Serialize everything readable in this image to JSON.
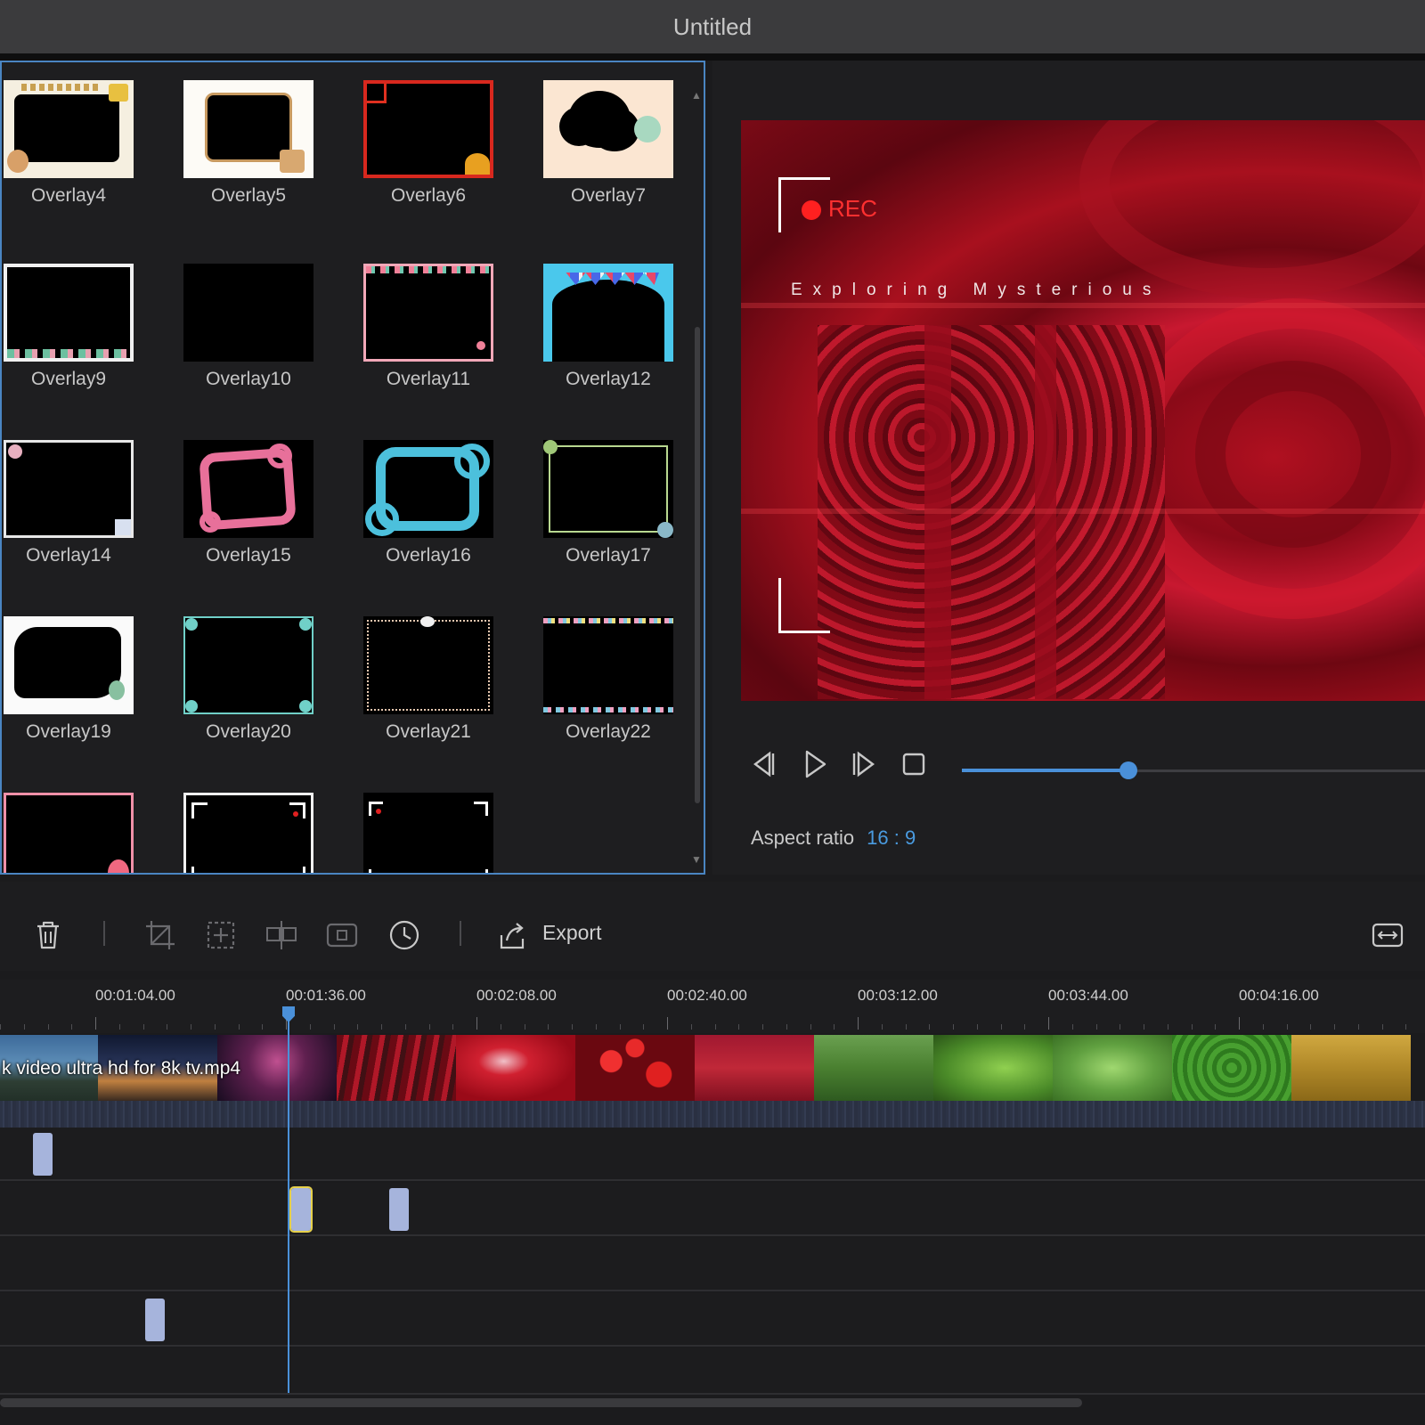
{
  "window": {
    "title": "Untitled"
  },
  "library": {
    "items": [
      {
        "label": "Overlay4"
      },
      {
        "label": "Overlay5"
      },
      {
        "label": "Overlay6"
      },
      {
        "label": "Overlay7"
      },
      {
        "label": "Overlay9"
      },
      {
        "label": "Overlay10"
      },
      {
        "label": "Overlay11"
      },
      {
        "label": "Overlay12"
      },
      {
        "label": "Overlay14"
      },
      {
        "label": "Overlay15"
      },
      {
        "label": "Overlay16"
      },
      {
        "label": "Overlay17"
      },
      {
        "label": "Overlay19"
      },
      {
        "label": "Overlay20"
      },
      {
        "label": "Overlay21"
      },
      {
        "label": "Overlay22"
      },
      {
        "label": ""
      },
      {
        "label": ""
      },
      {
        "label": ""
      }
    ]
  },
  "preview": {
    "rec_label": "REC",
    "subtitle": "Exploring Mysterious",
    "progress": 0.36,
    "aspect_label": "Aspect ratio",
    "aspect_value": "16 : 9"
  },
  "toolbar": {
    "export_label": "Export"
  },
  "timeline": {
    "ticks": [
      "00:01:04.00",
      "00:01:36.00",
      "00:02:08.00",
      "00:02:40.00",
      "00:03:12.00",
      "00:03:44.00",
      "00:04:16.00"
    ],
    "clip_name": "k video ultra hd for 8k tv.mp4"
  },
  "colors": {
    "accent": "#4a90d9",
    "selection": "#4a85c2",
    "rec": "#ff2020",
    "marker": "#a6b4dc"
  }
}
